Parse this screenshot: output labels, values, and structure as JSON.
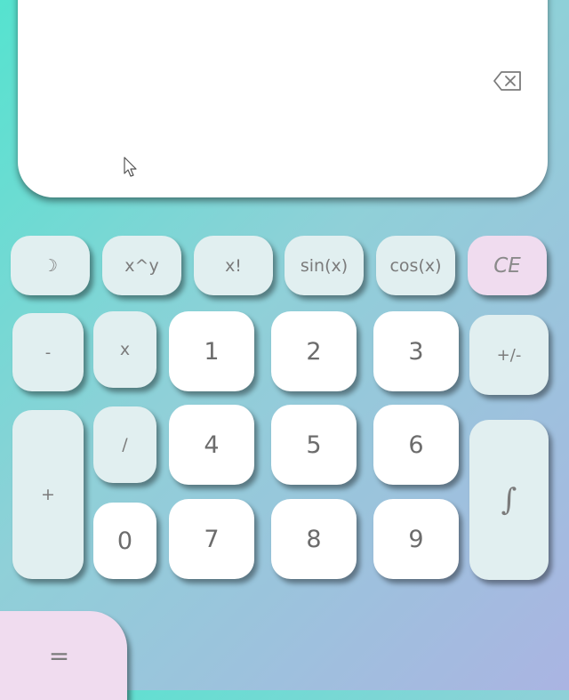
{
  "display": {
    "backspace_icon": "backspace-icon"
  },
  "keys": {
    "theme": "☽",
    "power": "x^y",
    "factorial": "x!",
    "sin": "sin(x)",
    "cos": "cos(x)",
    "clear": "CE",
    "minus": "-",
    "multiply": "x",
    "divide": "/",
    "plus": "+",
    "negate": "+/-",
    "integral": "∫",
    "equals": "=",
    "digits": [
      "0",
      "1",
      "2",
      "3",
      "4",
      "5",
      "6",
      "7",
      "8",
      "9"
    ]
  },
  "colors": {
    "background_start": "#55e3cf",
    "background_end": "#aab4e2",
    "function_key": "#e1eff0",
    "number_key": "#ffffff",
    "accent_pink": "#f0dcef",
    "text": "#7b7b7b"
  }
}
